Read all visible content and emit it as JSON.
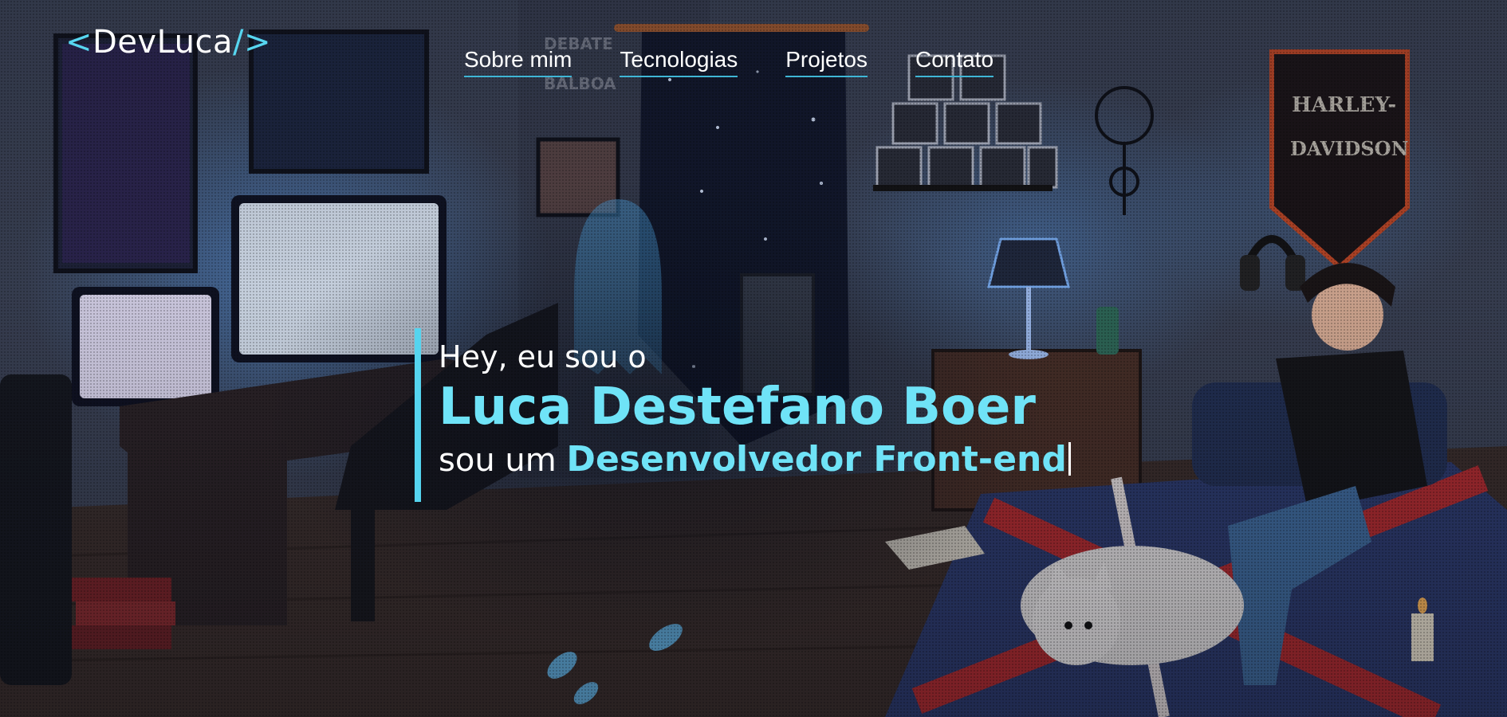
{
  "brand": {
    "open": "<",
    "name": "DevLuca",
    "close": "/>"
  },
  "nav": {
    "items": [
      {
        "label": "Sobre mim"
      },
      {
        "label": "Tecnologias"
      },
      {
        "label": "Projetos"
      },
      {
        "label": "Contato"
      }
    ]
  },
  "hero": {
    "intro": "Hey, eu sou o",
    "name": "Luca Destefano Boer",
    "role_prefix": "sou um",
    "role": "Desenvolvedor Front-end"
  },
  "background": {
    "poster_text": "DEBATE BALBOA",
    "pennant_text_1": "HARLEY-",
    "pennant_text_2": "DAVIDSON"
  },
  "colors": {
    "accent": "#6fe3f7",
    "accent_line": "#55d4ef",
    "nav_underline": "#3fb6d6",
    "text": "#ffffff",
    "wall": "#3b4255",
    "floor": "#3a2d2a"
  },
  "icons": {
    "ghost": "ghost-icon",
    "footprints": "footprints-icon",
    "dog": "dog-icon",
    "lamp": "lamp-icon",
    "dreamcatcher": "dreamcatcher-icon",
    "headphones": "headphones-icon"
  }
}
